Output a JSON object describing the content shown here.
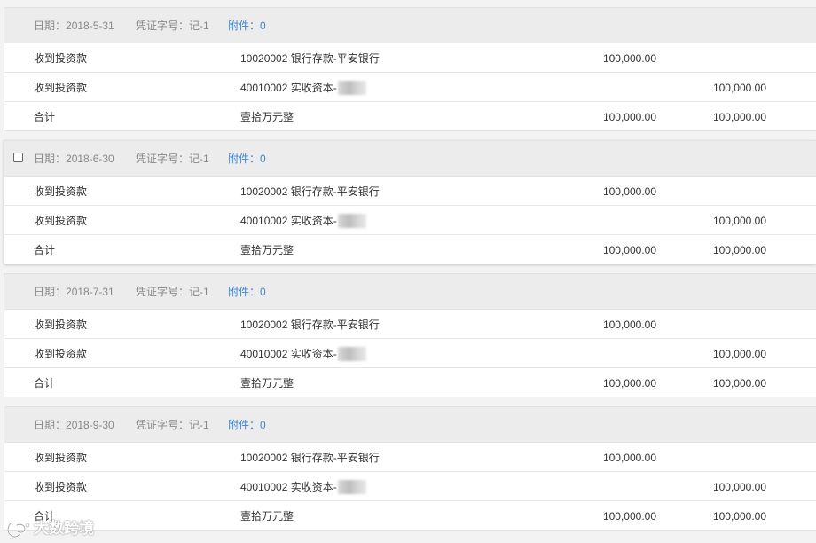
{
  "header_labels": {
    "date_prefix": "日期：",
    "voucher_prefix": "凭证字号：",
    "attach_prefix": "附件："
  },
  "vouchers": [
    {
      "date": "2018-5-31",
      "voucher_no": "记-1",
      "attachments": "0",
      "rows": [
        {
          "summary": "收到投资款",
          "account": "10020002 银行存款-平安银行",
          "debit": "100,000.00",
          "credit": ""
        },
        {
          "summary": "收到投资款",
          "account": "40010002 实收资本-",
          "debit": "",
          "credit": "100,000.00"
        },
        {
          "summary": "合计",
          "account": "壹拾万元整",
          "debit": "100,000.00",
          "credit": "100,000.00"
        }
      ]
    },
    {
      "date": "2018-6-30",
      "voucher_no": "记-1",
      "attachments": "0",
      "rows": [
        {
          "summary": "收到投资款",
          "account": "10020002 银行存款-平安银行",
          "debit": "100,000.00",
          "credit": ""
        },
        {
          "summary": "收到投资款",
          "account": "40010002 实收资本-",
          "debit": "",
          "credit": "100,000.00"
        },
        {
          "summary": "合计",
          "account": "壹拾万元整",
          "debit": "100,000.00",
          "credit": "100,000.00"
        }
      ]
    },
    {
      "date": "2018-7-31",
      "voucher_no": "记-1",
      "attachments": "0",
      "rows": [
        {
          "summary": "收到投资款",
          "account": "10020002 银行存款-平安银行",
          "debit": "100,000.00",
          "credit": ""
        },
        {
          "summary": "收到投资款",
          "account": "40010002 实收资本-",
          "debit": "",
          "credit": "100,000.00"
        },
        {
          "summary": "合计",
          "account": "壹拾万元整",
          "debit": "100,000.00",
          "credit": "100,000.00"
        }
      ]
    },
    {
      "date": "2018-9-30",
      "voucher_no": "记-1",
      "attachments": "0",
      "rows": [
        {
          "summary": "收到投资款",
          "account": "10020002 银行存款-平安银行",
          "debit": "100,000.00",
          "credit": ""
        },
        {
          "summary": "收到投资款",
          "account": "40010002 实收资本-",
          "debit": "",
          "credit": "100,000.00"
        },
        {
          "summary": "合计",
          "account": "壹拾万元整",
          "debit": "100,000.00",
          "credit": "100,000.00"
        }
      ]
    }
  ],
  "watermark": {
    "text": "大数跨境"
  },
  "colors": {
    "link": "#3a86d6",
    "header_bg": "#ececec",
    "muted": "#888888"
  }
}
